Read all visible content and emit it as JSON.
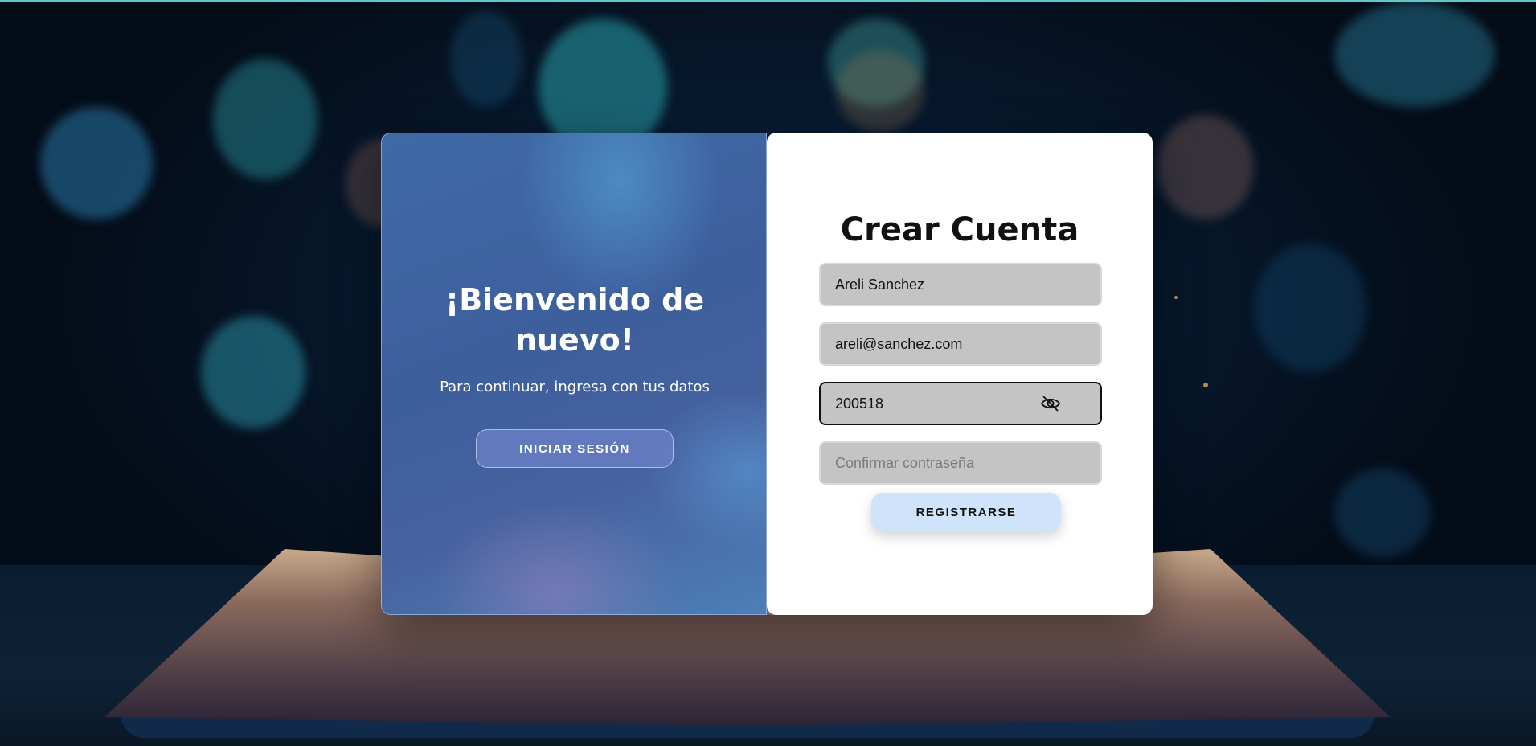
{
  "welcome": {
    "title": "¡Bienvenido de nuevo!",
    "subtitle": "Para continuar, ingresa con tus datos",
    "login_button": "INICIAR SESIÓN"
  },
  "register": {
    "title": "Crear Cuenta",
    "name_value": "Areli Sanchez",
    "email_value": "areli@sanchez.com",
    "password_value": "200518",
    "confirm_placeholder": "Confirmar contraseña",
    "submit_button": "REGISTRARSE"
  },
  "icons": {
    "password_toggle": "eye-off-icon"
  },
  "colors": {
    "panel_accent": "#3f6aa6",
    "register_button": "#cfe4fb",
    "field_bg": "#c4c4c4"
  }
}
